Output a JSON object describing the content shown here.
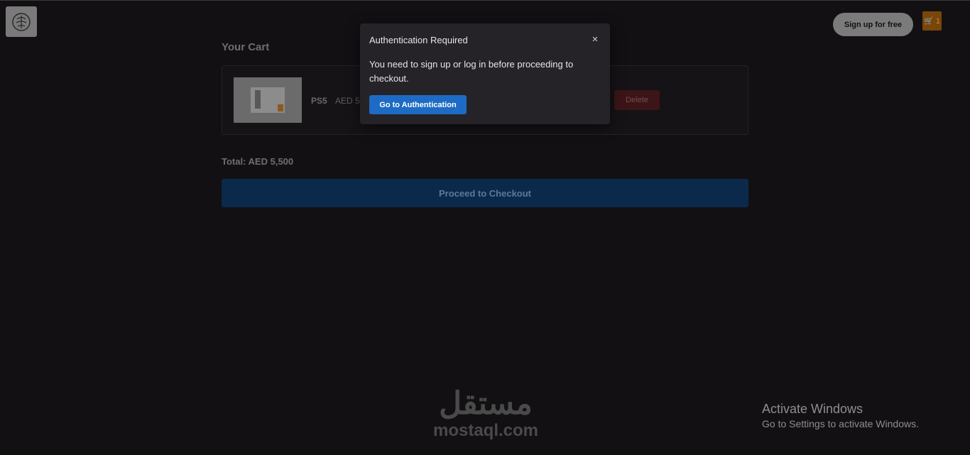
{
  "header": {
    "signup_label": "Sign up for free",
    "cart_badge": "🛒 1"
  },
  "cart": {
    "title": "Your Cart",
    "items": [
      {
        "name": "PS5",
        "price": "AED 5",
        "delete_label": "Delete"
      }
    ],
    "total": "Total: AED 5,500",
    "checkout_label": "Proceed to Checkout"
  },
  "modal": {
    "title": "Authentication Required",
    "close": "×",
    "message": "You need to sign up or log in before proceeding to checkout.",
    "button_label": "Go to Authentication"
  },
  "watermark": {
    "arabic": "مستقل",
    "latin": "mostaql.com"
  },
  "windows_notice": {
    "line1": "Activate Windows",
    "line2": "Go to Settings to activate Windows."
  }
}
